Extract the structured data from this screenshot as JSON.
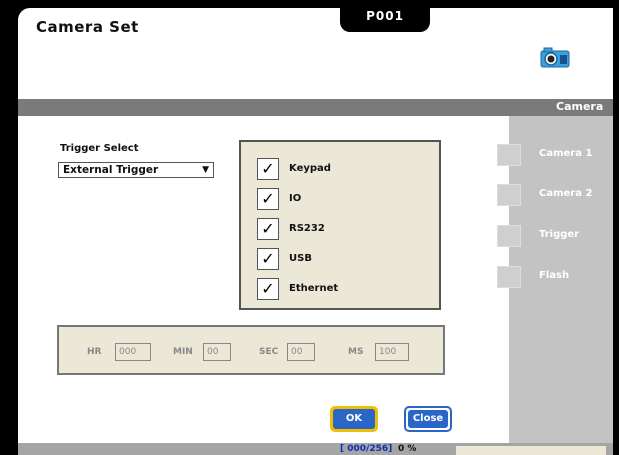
{
  "header": {
    "tab_label": "P001",
    "title": "Camera Set",
    "section_label": "Camera"
  },
  "sidebar": {
    "items": [
      {
        "label": "Camera 1",
        "icon": "camera-icon"
      },
      {
        "label": "Camera 2",
        "icon": "camera-icon"
      },
      {
        "label": "Trigger",
        "icon": "trigger-icon"
      },
      {
        "label": "Flash",
        "icon": "flash-icon"
      }
    ]
  },
  "trigger": {
    "label": "Trigger Select",
    "selected": "External Trigger"
  },
  "triggers": {
    "items": [
      {
        "label": "Keypad",
        "checked": true
      },
      {
        "label": "IO",
        "checked": true
      },
      {
        "label": "RS232",
        "checked": true
      },
      {
        "label": "USB",
        "checked": true
      },
      {
        "label": "Ethernet",
        "checked": true
      }
    ]
  },
  "timing": {
    "hr_label": "HR",
    "hr_value": "000",
    "min_label": "MIN",
    "min_value": "00",
    "sec_label": "SEC",
    "sec_value": "00",
    "ms_label": "MS",
    "ms_value": "100"
  },
  "buttons": {
    "ok": "OK",
    "close": "Close"
  },
  "status": {
    "counter": "[ 000/256]",
    "percent": "0 %"
  },
  "colors": {
    "accent": "#2a66c8",
    "focus": "#f0c000",
    "sidebar": "#c3c3c3",
    "panel": "#ece8d8"
  }
}
